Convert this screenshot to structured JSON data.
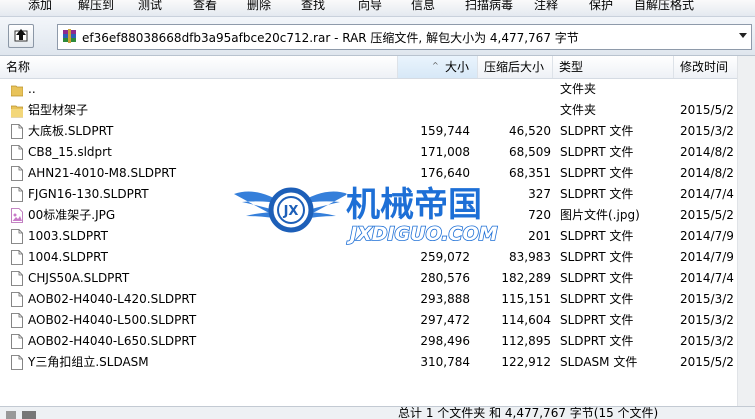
{
  "toolbar": {
    "buttons": [
      "添加",
      "解压到",
      "测试",
      "查看",
      "删除",
      "查找",
      "向导",
      "信息",
      "扫描病毒",
      "注释",
      "保护",
      "自解压格式"
    ]
  },
  "address": {
    "text": "ef36ef88038668dfb3a95afbce20c712.rar - RAR 压缩文件, 解包大小为 4,477,767 字节"
  },
  "columns": {
    "name": "名称",
    "size": "大小",
    "packed": "压缩后大小",
    "type": "类型",
    "modified": "修改时间"
  },
  "files": [
    {
      "icon": "parent-folder-icon",
      "name": "..",
      "size": "",
      "packed": "",
      "type": "文件夹",
      "modified": ""
    },
    {
      "icon": "folder-icon",
      "name": "铝型材架子",
      "size": "",
      "packed": "",
      "type": "文件夹",
      "modified": "2015/5/2"
    },
    {
      "icon": "document-icon",
      "name": "大底板.SLDPRT",
      "size": "159,744",
      "packed": "46,520",
      "type": "SLDPRT 文件",
      "modified": "2015/3/2"
    },
    {
      "icon": "document-icon",
      "name": "CB8_15.sldprt",
      "size": "171,008",
      "packed": "68,509",
      "type": "SLDPRT 文件",
      "modified": "2014/8/2"
    },
    {
      "icon": "document-icon",
      "name": "AHN21-4010-M8.SLDPRT",
      "size": "176,640",
      "packed": "68,351",
      "type": "SLDPRT 文件",
      "modified": "2014/8/2"
    },
    {
      "icon": "document-icon",
      "name": "FJGN16-130.SLDPRT",
      "size": "",
      "packed": "327",
      "type": "SLDPRT 文件",
      "modified": "2014/7/4"
    },
    {
      "icon": "image-file-icon",
      "name": "00标准架子.JPG",
      "size": "",
      "packed": "720",
      "type": "图片文件(.jpg)",
      "modified": "2015/5/2"
    },
    {
      "icon": "document-icon",
      "name": "1003.SLDPRT",
      "size": "",
      "packed": "201",
      "type": "SLDPRT 文件",
      "modified": "2014/7/9"
    },
    {
      "icon": "document-icon",
      "name": "1004.SLDPRT",
      "size": "259,072",
      "packed": "83,983",
      "type": "SLDPRT 文件",
      "modified": "2014/7/9"
    },
    {
      "icon": "document-icon",
      "name": "CHJS50A.SLDPRT",
      "size": "280,576",
      "packed": "182,289",
      "type": "SLDPRT 文件",
      "modified": "2014/7/4"
    },
    {
      "icon": "document-icon",
      "name": "AOB02-H4040-L420.SLDPRT",
      "size": "293,888",
      "packed": "115,151",
      "type": "SLDPRT 文件",
      "modified": "2015/3/2"
    },
    {
      "icon": "document-icon",
      "name": "AOB02-H4040-L500.SLDPRT",
      "size": "297,472",
      "packed": "114,604",
      "type": "SLDPRT 文件",
      "modified": "2015/3/2"
    },
    {
      "icon": "document-icon",
      "name": "AOB02-H4040-L650.SLDPRT",
      "size": "298,496",
      "packed": "112,895",
      "type": "SLDPRT 文件",
      "modified": "2015/3/2"
    },
    {
      "icon": "document-icon",
      "name": "Y三角扣组立.SLDASM",
      "size": "310,784",
      "packed": "122,912",
      "type": "SLDASM 文件",
      "modified": "2015/5/2"
    }
  ],
  "watermark": {
    "title": "机械帝国",
    "url": "JXDIGUO.COM",
    "emblem_letters": "JX"
  },
  "status": {
    "text": "总计 1 个文件夹 和 4,477,767 字节(15 个文件)"
  },
  "colors": {
    "watermark_blue": "#1d6fd6",
    "folder": "#e8c35a",
    "selection_header": "#d7e8f7"
  }
}
